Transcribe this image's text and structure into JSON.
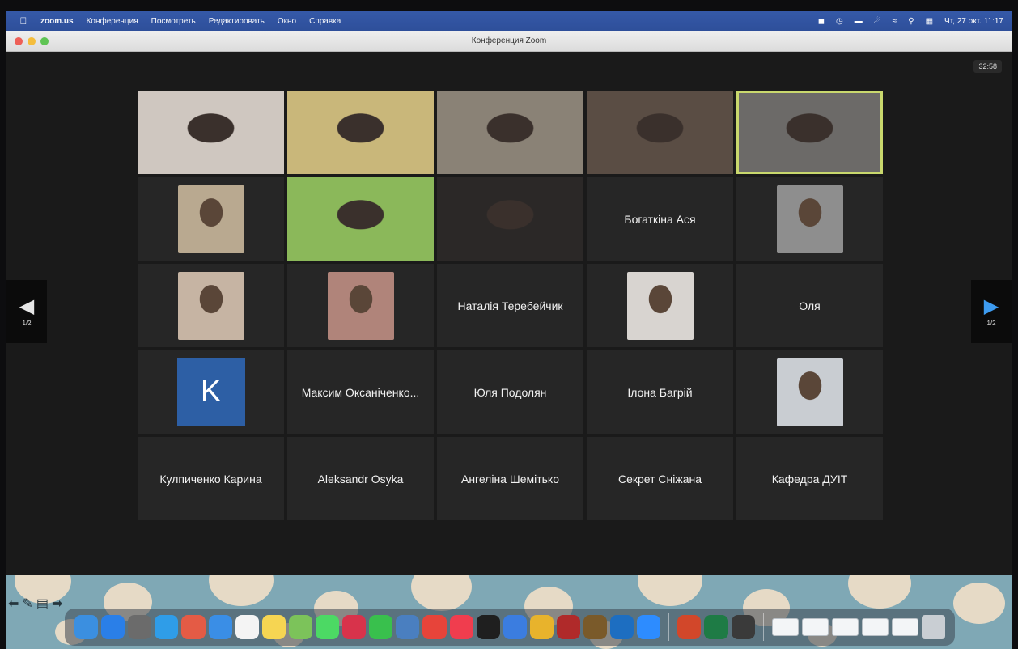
{
  "menubar": {
    "app": "zoom.us",
    "items": [
      "Конференция",
      "Посмотреть",
      "Редактировать",
      "Окно",
      "Справка"
    ],
    "clock": "Чт, 27 окт. 11:17"
  },
  "window": {
    "title": "Конференция Zoom"
  },
  "meeting": {
    "timer": "32:58",
    "page_indicator_prev": "1/2",
    "page_indicator_next": "1/2",
    "tiles": [
      {
        "kind": "video",
        "name": "",
        "bg": "#cfc7c0"
      },
      {
        "kind": "video",
        "name": "",
        "bg": "#c9b77a"
      },
      {
        "kind": "video",
        "name": "",
        "bg": "#8a8276"
      },
      {
        "kind": "video",
        "name": "",
        "bg": "#5a4d44"
      },
      {
        "kind": "video",
        "name": "",
        "bg": "#6c6a68",
        "active": true
      },
      {
        "kind": "photo",
        "name": "",
        "bg": "#b9a990"
      },
      {
        "kind": "video",
        "name": "",
        "bg": "#8bb85a"
      },
      {
        "kind": "video",
        "name": "",
        "bg": "#2b2827"
      },
      {
        "kind": "name",
        "name": "Богаткіна Ася"
      },
      {
        "kind": "photo",
        "name": "",
        "bg": "#8e8e8e"
      },
      {
        "kind": "photo",
        "name": "",
        "bg": "#c6b4a3"
      },
      {
        "kind": "photo",
        "name": "",
        "bg": "#b0847a"
      },
      {
        "kind": "name",
        "name": "Наталія Теребейчик"
      },
      {
        "kind": "photo",
        "name": "",
        "bg": "#d8d4d0"
      },
      {
        "kind": "name",
        "name": "Оля"
      },
      {
        "kind": "avatar",
        "name": "",
        "letter": "K"
      },
      {
        "kind": "name",
        "name": "Максим Оксаніченко..."
      },
      {
        "kind": "name",
        "name": "Юля Подолян"
      },
      {
        "kind": "name",
        "name": "Ілона Багрій"
      },
      {
        "kind": "photo",
        "name": "",
        "bg": "#c9cdd2"
      },
      {
        "kind": "name",
        "name": "Кулпиченко Карина"
      },
      {
        "kind": "name",
        "name": "Aleksandr Osyka"
      },
      {
        "kind": "name",
        "name": "Ангеліна Шемітько"
      },
      {
        "kind": "name",
        "name": "Секрет Сніжана"
      },
      {
        "kind": "name",
        "name": "Кафедра ДУІТ"
      }
    ]
  },
  "dock": {
    "apps": [
      {
        "icon": "finder-icon",
        "color": "#3b8fe0"
      },
      {
        "icon": "app-store-icon",
        "color": "#2a7fe8"
      },
      {
        "icon": "system-preferences-icon",
        "color": "#6b6b6b"
      },
      {
        "icon": "safari-icon",
        "color": "#2f9de8"
      },
      {
        "icon": "launchpad-icon",
        "color": "#e45b45"
      },
      {
        "icon": "mail-icon",
        "color": "#3a8ee6"
      },
      {
        "icon": "calendar-icon",
        "color": "#f4f4f4"
      },
      {
        "icon": "notes-icon",
        "color": "#f6d552"
      },
      {
        "icon": "photos-icon",
        "color": "#7cc35a"
      },
      {
        "icon": "messages-icon",
        "color": "#4cd964"
      },
      {
        "icon": "photo-booth-icon",
        "color": "#d8334b"
      },
      {
        "icon": "facetime-icon",
        "color": "#39c04d"
      },
      {
        "icon": "preview-icon",
        "color": "#4a7fc0"
      },
      {
        "icon": "chrome-icon",
        "color": "#e7443a"
      },
      {
        "icon": "music-icon",
        "color": "#f03d4e"
      },
      {
        "icon": "apple-tv-icon",
        "color": "#1f1f1f"
      },
      {
        "icon": "finder-alt-icon",
        "color": "#3b7de0"
      },
      {
        "icon": "chrome-alt-icon",
        "color": "#e8b32c"
      },
      {
        "icon": "dictionary-icon",
        "color": "#b02a2a"
      },
      {
        "icon": "game-icon",
        "color": "#7a5a2a"
      },
      {
        "icon": "outlook-icon",
        "color": "#1d6ec1"
      },
      {
        "icon": "zoom-icon",
        "color": "#2d8cff"
      },
      {
        "icon": "powerpoint-icon",
        "color": "#d2472a"
      },
      {
        "icon": "excel-icon",
        "color": "#1e7b45"
      },
      {
        "icon": "screenshot-icon",
        "color": "#3a3a3a"
      }
    ],
    "files": 5,
    "trash_icon": "trash-icon"
  }
}
